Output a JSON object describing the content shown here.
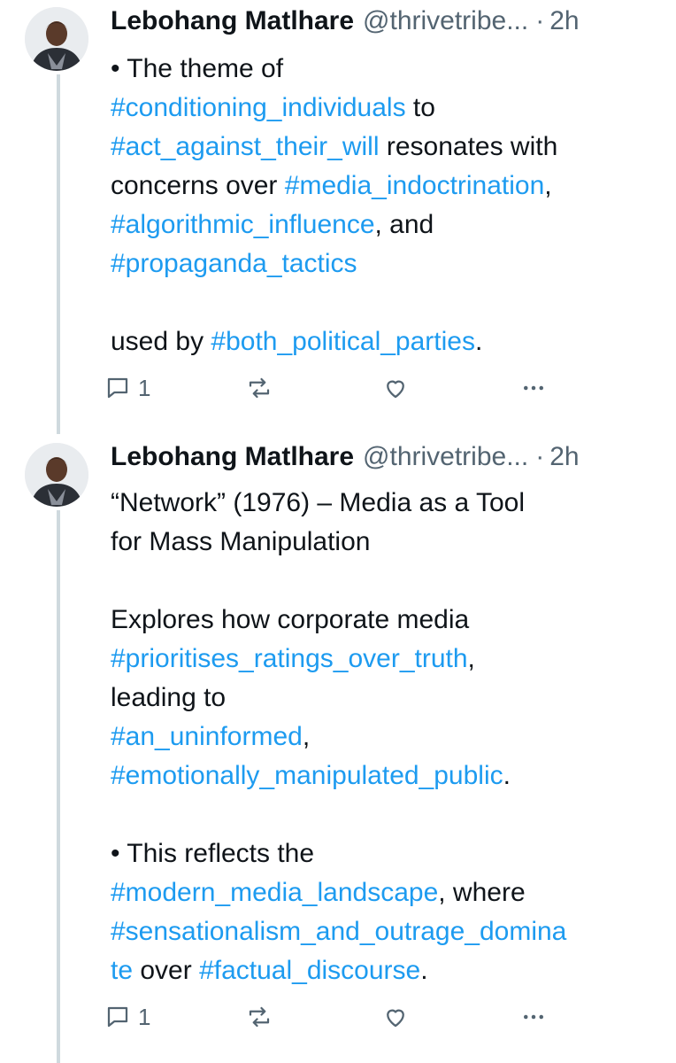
{
  "tweets": [
    {
      "author": {
        "name": "Lebohang Matlhare",
        "handle": "@thrivetribe...",
        "dot": "·",
        "time": "2h"
      },
      "lines": [
        [
          {
            "t": "• The theme of",
            "tag": false
          }
        ],
        [
          {
            "t": "#conditioning_individuals",
            "tag": true
          },
          {
            "t": " to",
            "tag": false
          }
        ],
        [
          {
            "t": "#act_against_their_will",
            "tag": true
          },
          {
            "t": " resonates with",
            "tag": false
          }
        ],
        [
          {
            "t": "concerns over ",
            "tag": false
          },
          {
            "t": "#media_indoctrination",
            "tag": true
          },
          {
            "t": ",",
            "tag": false
          }
        ],
        [
          {
            "t": "#algorithmic_influence",
            "tag": true
          },
          {
            "t": ", and",
            "tag": false
          }
        ],
        [
          {
            "t": "#propaganda_tactics",
            "tag": true
          }
        ],
        [],
        [
          {
            "t": "used by ",
            "tag": false
          },
          {
            "t": "#both_political_parties",
            "tag": true
          },
          {
            "t": ".",
            "tag": false
          }
        ]
      ],
      "actions": {
        "reply_count": "1",
        "reply_icon": "reply-icon",
        "retweet_icon": "retweet-icon",
        "like_icon": "like-icon",
        "more_icon": "more-icon"
      }
    },
    {
      "author": {
        "name": "Lebohang Matlhare",
        "handle": "@thrivetribe...",
        "dot": "·",
        "time": "2h"
      },
      "lines": [
        [
          {
            "t": "“Network” (1976) – Media as a Tool",
            "tag": false
          }
        ],
        [
          {
            "t": "for Mass Manipulation",
            "tag": false
          }
        ],
        [],
        [
          {
            "t": "Explores how corporate media",
            "tag": false
          }
        ],
        [
          {
            "t": "#prioritises_ratings_over_truth",
            "tag": true
          },
          {
            "t": ",",
            "tag": false
          }
        ],
        [
          {
            "t": "leading to",
            "tag": false
          }
        ],
        [
          {
            "t": "#an_uninformed",
            "tag": true
          },
          {
            "t": ",",
            "tag": false
          }
        ],
        [
          {
            "t": "#emotionally_manipulated_public",
            "tag": true
          },
          {
            "t": ".",
            "tag": false
          }
        ],
        [],
        [
          {
            "t": "• This reflects the",
            "tag": false
          }
        ],
        [
          {
            "t": "#modern_media_landscape",
            "tag": true
          },
          {
            "t": ", where",
            "tag": false
          }
        ],
        [
          {
            "t": "#sensationalism_and_outrage_domina",
            "tag": true
          }
        ],
        [
          {
            "t": "te",
            "tag": true
          },
          {
            "t": " over ",
            "tag": false
          },
          {
            "t": "#factual_discourse",
            "tag": true
          },
          {
            "t": ".",
            "tag": false
          }
        ]
      ],
      "actions": {
        "reply_count": "1",
        "reply_icon": "reply-icon",
        "retweet_icon": "retweet-icon",
        "like_icon": "like-icon",
        "more_icon": "more-icon"
      }
    }
  ],
  "colors": {
    "link": "#1d9bf0",
    "text": "#0f1419",
    "muted": "#536471",
    "thread_line": "#cfd9de"
  }
}
